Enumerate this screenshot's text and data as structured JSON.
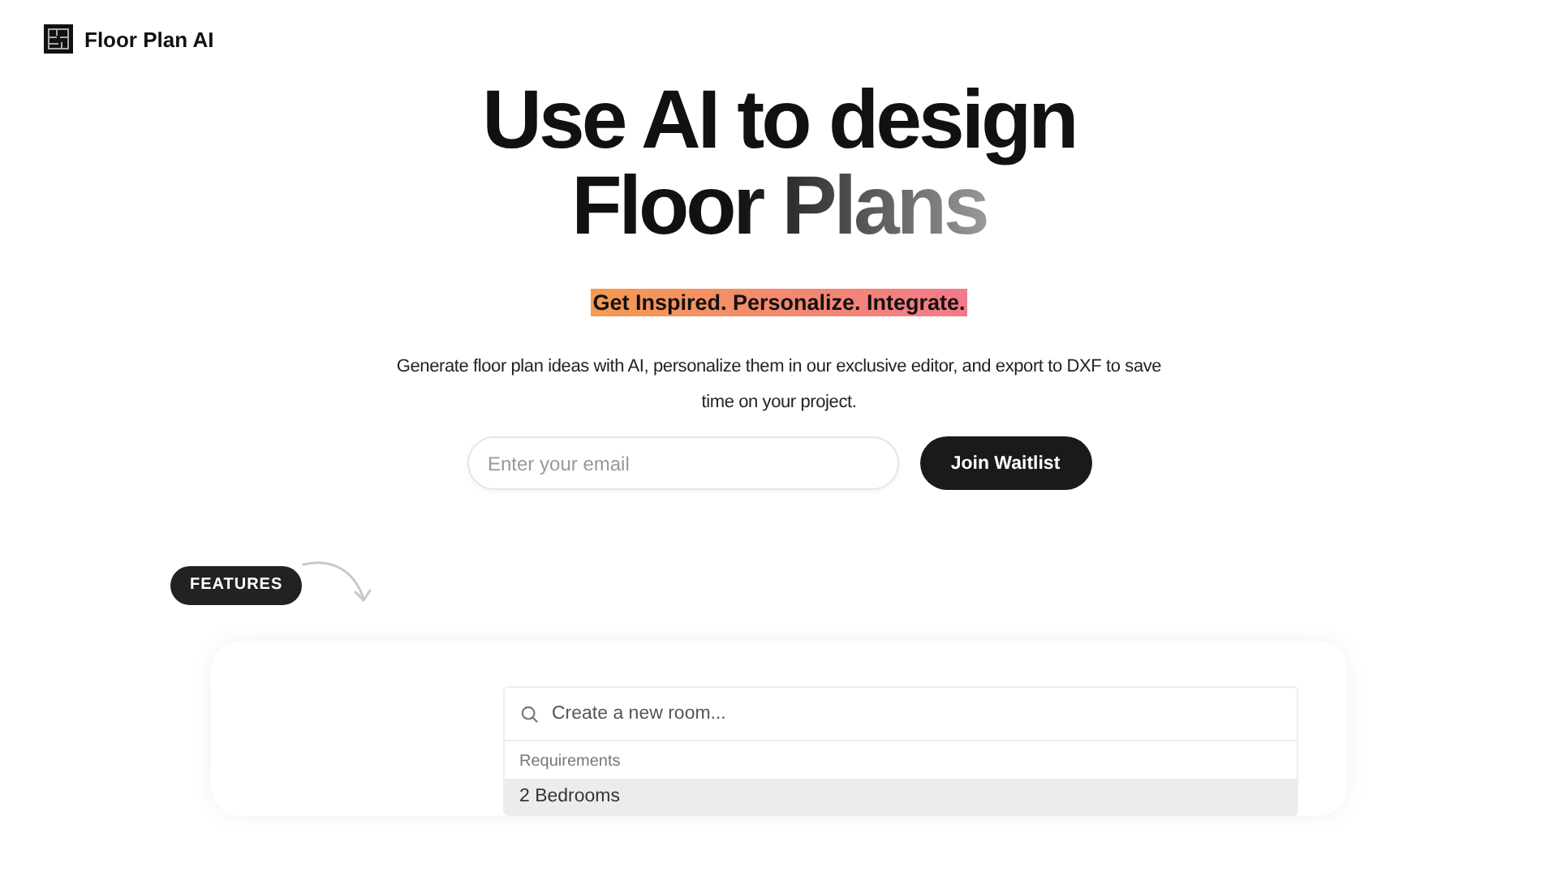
{
  "brand": {
    "name": "Floor Plan AI"
  },
  "hero": {
    "title_lines": [
      "Use AI to design",
      "Floor Plans"
    ],
    "tagline": "Get Inspired. Personalize. Integrate.",
    "description": "Generate floor plan ideas with AI, personalize them in our exclusive editor, and export to DXF to save time on your project."
  },
  "signup": {
    "placeholder": "Enter your email",
    "button": "Join Waitlist"
  },
  "features": {
    "badge": "FEATURES",
    "command": {
      "placeholder": "Create a new room...",
      "group": "Requirements",
      "items": [
        {
          "label": "2 Bedrooms",
          "selected": true
        }
      ]
    }
  }
}
